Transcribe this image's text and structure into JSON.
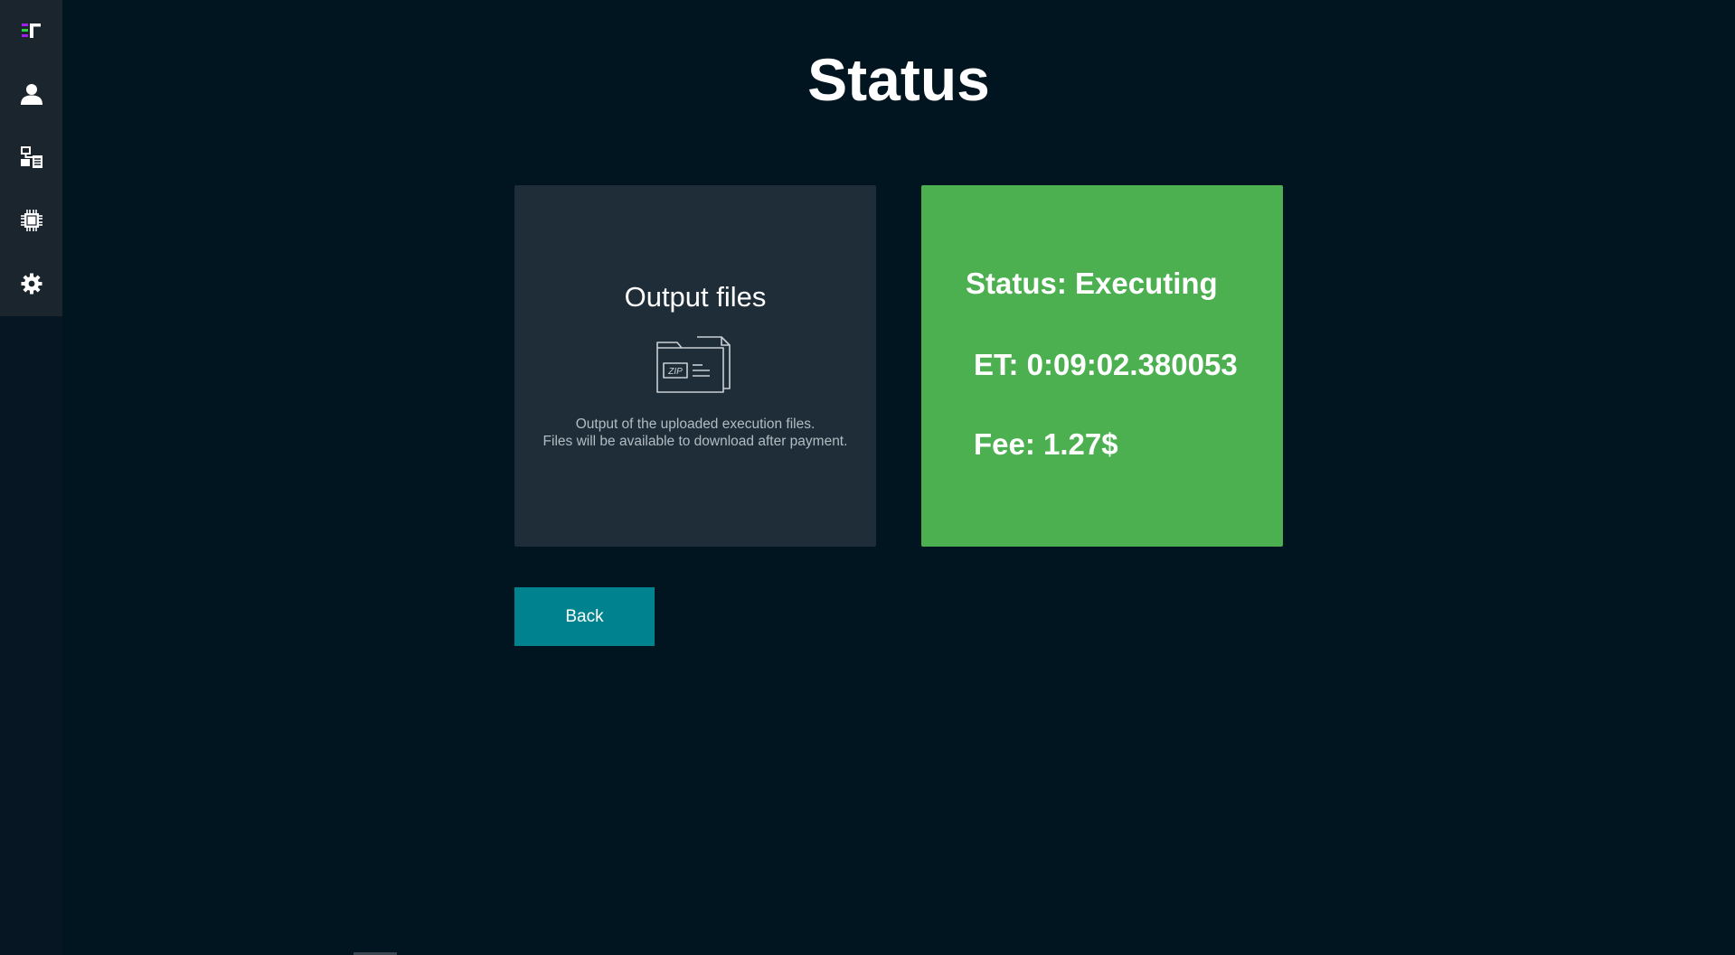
{
  "page": {
    "title": "Status"
  },
  "sidebar": {
    "items": [
      {
        "name": "app-logo",
        "icon": "logo-icon"
      },
      {
        "name": "profile",
        "icon": "user-icon"
      },
      {
        "name": "jobs",
        "icon": "network-document-icon"
      },
      {
        "name": "processors",
        "icon": "chip-icon"
      },
      {
        "name": "settings",
        "icon": "gear-icon"
      }
    ]
  },
  "output_card": {
    "title": "Output files",
    "icon": "zip-folder-icon",
    "description_line1": "Output of the uploaded execution files.",
    "description_line2": "Files will be available to download after payment."
  },
  "status_card": {
    "status": "Status: Executing",
    "elapsed_time": "ET: 0:09:02.380053",
    "fee": "Fee: 1.27$",
    "color": "#4caf50"
  },
  "actions": {
    "back_label": "Back",
    "back_color": "#00838f"
  },
  "colors": {
    "background": "#011520",
    "sidebar": "#1b252d",
    "card": "#1e2d38",
    "logo_accent_purple": "#a020f0",
    "logo_accent_green": "#2ecc40"
  }
}
